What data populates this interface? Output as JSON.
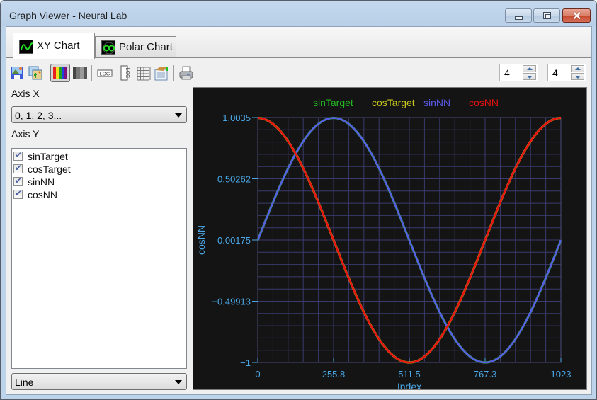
{
  "window": {
    "title": "Graph Viewer - Neural Lab",
    "controls": [
      "minimize",
      "maximize",
      "close"
    ]
  },
  "tabs": [
    {
      "label": "XY Chart",
      "icon": "xy-chart-icon",
      "active": true
    },
    {
      "label": "Polar Chart",
      "icon": "polar-chart-icon",
      "active": false
    }
  ],
  "toolbar": {
    "buttons": [
      {
        "name": "save-image",
        "icon": "save-image-icon"
      },
      {
        "name": "copy-image",
        "icon": "copy-image-icon"
      },
      {
        "name": "color-mode",
        "icon": "color-bars-icon",
        "pressed": true
      },
      {
        "name": "grayscale-mode",
        "icon": "gray-bars-icon"
      },
      {
        "name": "log-x",
        "icon": "log-x-icon"
      },
      {
        "name": "log-y",
        "icon": "log-y-icon"
      },
      {
        "name": "grid",
        "icon": "grid-icon"
      },
      {
        "name": "properties",
        "icon": "properties-icon"
      },
      {
        "name": "print",
        "icon": "printer-icon"
      }
    ],
    "spin1": "4",
    "spin2": "4"
  },
  "sidebar": {
    "axis_x_label": "Axis X",
    "axis_x_value": "0, 1, 2, 3...",
    "axis_y_label": "Axis Y",
    "series": [
      {
        "label": "sinTarget",
        "checked": true
      },
      {
        "label": "cosTarget",
        "checked": true
      },
      {
        "label": "sinNN",
        "checked": true
      },
      {
        "label": "cosNN",
        "checked": true
      }
    ],
    "chart_type": "Line"
  },
  "colors": {
    "chart_bg": "#141414",
    "grid": "#3a3a6e",
    "axis_text": "#4aa8e8",
    "sinTarget": "#22bb22",
    "cosTarget": "#c8c820",
    "sinNN": "#5a5ae8",
    "cosNN": "#e81010"
  },
  "chart_data": {
    "type": "line",
    "title": "",
    "xlabel": "Index",
    "ylabel": "cosNN",
    "xlim": [
      0,
      1023
    ],
    "ylim": [
      -1,
      1.0035
    ],
    "x_ticks": [
      "0",
      "255.8",
      "511.5",
      "767.3",
      "1023"
    ],
    "y_ticks": [
      "1.0035",
      "0.50262",
      "0.00175",
      "−0.49913",
      "−1"
    ],
    "grid": true,
    "legend": "top-center",
    "series": [
      {
        "name": "sinTarget",
        "function": "sin(2*pi*x/1023)",
        "n_points": 1024,
        "color": "#22bb22"
      },
      {
        "name": "cosTarget",
        "function": "cos(2*pi*x/1023)",
        "n_points": 1024,
        "color": "#c8c820"
      },
      {
        "name": "sinNN",
        "function": "sin(2*pi*x/1023)",
        "n_points": 1024,
        "color": "#5a5ae8"
      },
      {
        "name": "cosNN",
        "function": "cos(2*pi*x/1023)",
        "n_points": 1024,
        "color": "#e81010"
      }
    ]
  }
}
